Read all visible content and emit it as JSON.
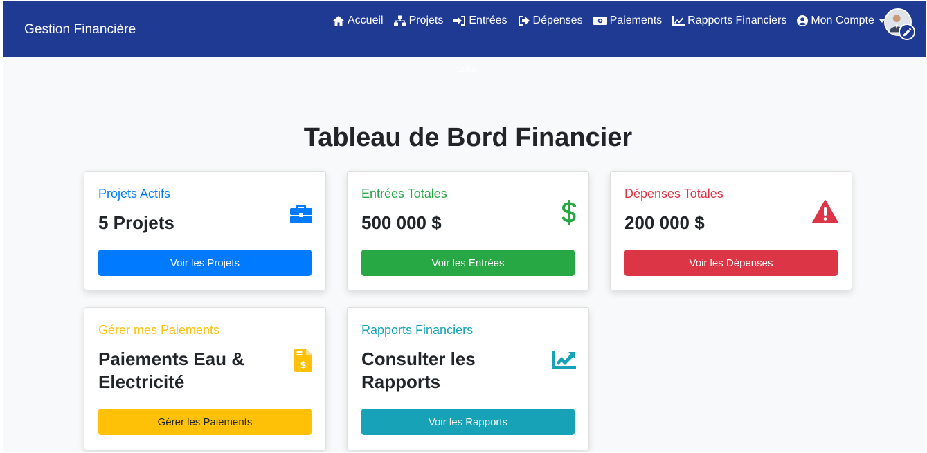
{
  "navbar": {
    "brand": "Gestion Financière",
    "items": [
      {
        "label": "Accueil",
        "icon": "home-icon"
      },
      {
        "label": "Projets",
        "icon": "sitemap-icon"
      },
      {
        "label": "Entrées",
        "icon": "sign-in-icon"
      },
      {
        "label": "Dépenses",
        "icon": "sign-out-icon"
      },
      {
        "label": "Paiements",
        "icon": "money-bill-icon"
      },
      {
        "label": "Rapports Financiers",
        "icon": "chart-line-icon"
      },
      {
        "label": "Mon Compte",
        "icon": "user-circle-icon"
      }
    ],
    "username": "Luka"
  },
  "page": {
    "title": "Tableau de Bord Financier"
  },
  "cards": [
    {
      "subtitle": "Projets Actifs",
      "value": "5 Projets",
      "button": "Voir les Projets",
      "color": "#007bff",
      "icon": "briefcase-icon"
    },
    {
      "subtitle": "Entrées Totales",
      "value": "500 000 $",
      "button": "Voir les Entrées",
      "color": "#28a745",
      "icon": "dollar-sign-icon"
    },
    {
      "subtitle": "Dépenses Totales",
      "value": "200 000 $",
      "button": "Voir les Dépenses",
      "color": "#dc3545",
      "icon": "exclamation-triangle-icon"
    },
    {
      "subtitle": "Gérer mes Paiements",
      "value_line1": "Paiements Eau &",
      "value_line2": "Electricité",
      "button": "Gérer les Paiements",
      "color": "#ffc107",
      "icon": "file-invoice-dollar-icon"
    },
    {
      "subtitle": "Rapports Financiers",
      "value_line1": "Consulter les",
      "value_line2": "Rapports",
      "button": "Voir les Rapports",
      "color": "#17a2b8",
      "icon": "chart-area-icon"
    }
  ],
  "colors": {
    "navbar": "#1f3a93",
    "background": "#f8f9fa"
  }
}
